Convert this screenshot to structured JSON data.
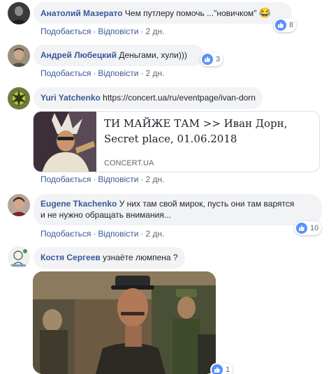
{
  "comments": [
    {
      "author": "Анатолий Мазерато",
      "text": "Чем путлеру помочь ...\"новичком\"",
      "emoji": "😂",
      "like_label": "Подобається",
      "reply_label": "Відповісти",
      "time": "2 дн.",
      "reactions": "8"
    },
    {
      "author": "Андрей Любецкий",
      "text": "Деньгами, хули)))",
      "like_label": "Подобається",
      "reply_label": "Відповісти",
      "time": "2 дн.",
      "reactions": "3"
    },
    {
      "author": "Yuri Yatchenko",
      "text": "https://concert.ua/ru/eventpage/ivan-dorn",
      "link_preview": {
        "title": "ТИ МАЙЖЕ ТАМ >> Иван Дорн, Secret place, 01.06.2018",
        "domain": "CONCERT.UA"
      },
      "like_label": "Подобається",
      "reply_label": "Відповісти",
      "time": "2 дн."
    },
    {
      "author": "Eugene Tkachenko",
      "text_line1": "У них там свой мирок, пусть они там варятся",
      "text_line2": "и не нужно обращать внимания...",
      "like_label": "Подобається",
      "reply_label": "Відповісти",
      "time": "2 дн.",
      "reactions": "10"
    },
    {
      "author": "Костя Сергеев",
      "text": "узнаёте люмпена ?",
      "reactions": "1"
    }
  ],
  "colors": {
    "author_link": "#385898",
    "bubble_bg": "#f2f3f5",
    "like_badge": "#5890ff",
    "meta_text": "#606770"
  },
  "icons": {
    "reaction": "thumbs-up-icon"
  }
}
